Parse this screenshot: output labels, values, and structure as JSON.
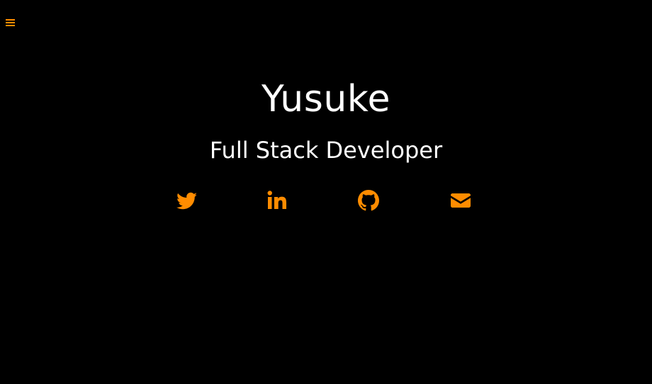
{
  "menu": {
    "icon": "hamburger-menu-icon",
    "color": "#ff8c00"
  },
  "hero": {
    "name": "Yusuke",
    "role": "Full Stack Developer"
  },
  "social": {
    "accent_color": "#ff8c00",
    "links": [
      {
        "icon": "twitter-icon"
      },
      {
        "icon": "linkedin-icon"
      },
      {
        "icon": "github-icon"
      },
      {
        "icon": "email-icon"
      }
    ]
  },
  "colors": {
    "background": "#000000",
    "text": "#ffffff",
    "accent": "#ff8c00"
  }
}
